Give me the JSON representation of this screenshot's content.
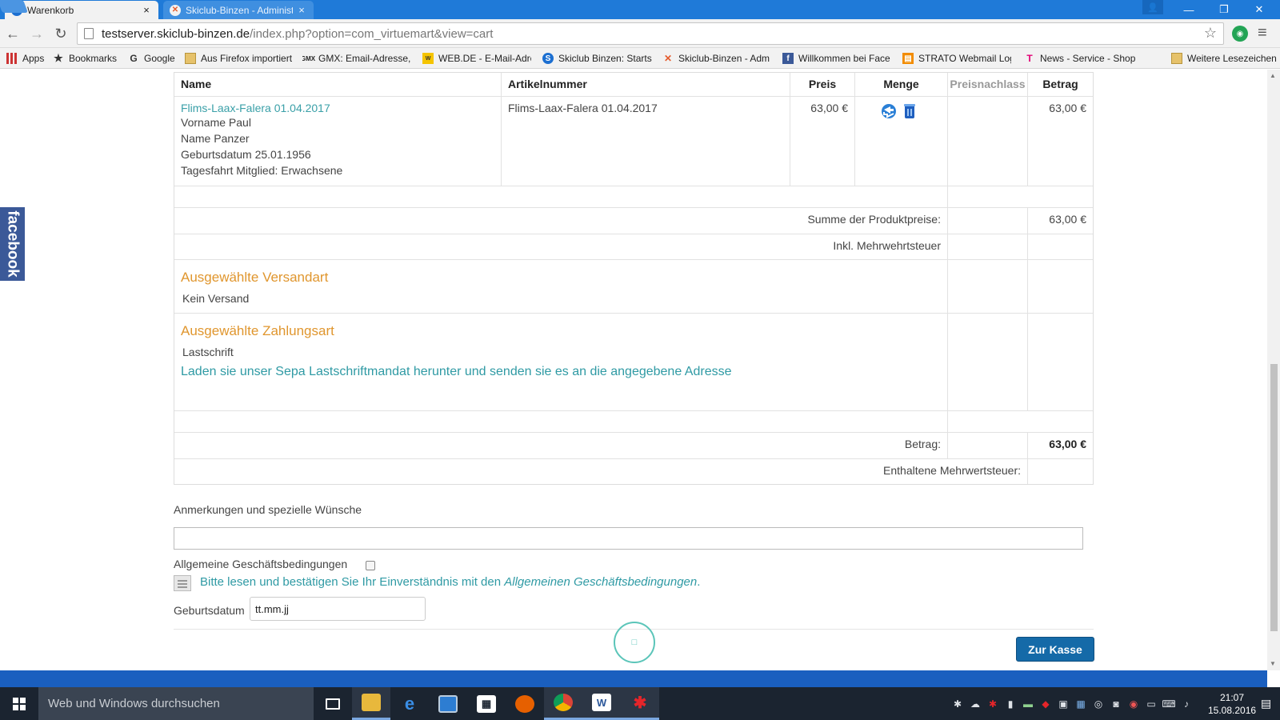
{
  "browser": {
    "tabs": [
      {
        "title": "Warenkorb",
        "close": "×",
        "favicon": "S"
      },
      {
        "title": "Skiclub-Binzen - Administ",
        "close": "×",
        "favicon": "✕"
      }
    ],
    "window_buttons": {
      "minimize": "—",
      "restore": "❐",
      "close": "✕",
      "profile": "👤"
    },
    "nav": {
      "back": "←",
      "forward": "→",
      "reload": "↻"
    },
    "url_host": "testserver.skiclub-binzen.de",
    "url_path": "/index.php?option=com_virtuemart&view=cart",
    "star": "☆",
    "menu": "≡",
    "bookmarks": [
      {
        "label": "Apps",
        "icon": "apps-icon"
      },
      {
        "label": "Bookmarks",
        "icon": "star-icon"
      },
      {
        "label": "Google",
        "icon": "google-icon"
      },
      {
        "label": "Aus Firefox importiert",
        "icon": "folder-icon"
      },
      {
        "label": "GMX: Email-Adresse,",
        "icon": "gmx-icon"
      },
      {
        "label": "WEB.DE - E-Mail-Adre",
        "icon": "webde-icon"
      },
      {
        "label": "Skiclub Binzen: Starts",
        "icon": "skiclub-icon"
      },
      {
        "label": "Skiclub-Binzen - Adm",
        "icon": "joomla-icon"
      },
      {
        "label": "Willkommen bei Face",
        "icon": "facebook-icon"
      },
      {
        "label": "STRATO Webmail Log",
        "icon": "strato-icon"
      },
      {
        "label": "News - Service - Shop",
        "icon": "telekom-icon"
      },
      {
        "label": "Weitere Lesezeichen",
        "icon": "folder-icon"
      }
    ]
  },
  "facebook_tab": "facebook",
  "cart": {
    "headers": {
      "name": "Name",
      "sku": "Artikelnummer",
      "price": "Preis",
      "qty": "Menge",
      "discount": "Preisnachlass",
      "total": "Betrag"
    },
    "item": {
      "link": "Flims-Laax-Falera 01.04.2017",
      "lines": [
        "Vorname Paul",
        "Name Panzer",
        "Geburtsdatum 25.01.1956",
        "Tagesfahrt Mitglied: Erwachsene"
      ],
      "sku": "Flims-Laax-Falera 01.04.2017",
      "price": "63,00 €",
      "total": "63,00 €"
    },
    "subtotal_label": "Summe der Produktpreise:",
    "subtotal_value": "63,00 €",
    "vat_included": "Inkl. Mehrwehrtsteuer",
    "shipping_title": "Ausgewählte Versandart",
    "shipping_value": "Kein Versand",
    "payment_title": "Ausgewählte Zahlungsart",
    "payment_value": "Lastschrift",
    "payment_note": "Laden sie unser Sepa Lastschriftmandat herunter und senden sie es an die angegebene Adresse",
    "total_label": "Betrag:",
    "total_value": "63,00 €",
    "vat_contained": "Enthaltene Mehrwertsteuer:"
  },
  "form": {
    "notes_label": "Anmerkungen und spezielle Wünsche",
    "agb_label": "Allgemeine Geschäftsbedingungen",
    "agb_text": "Bitte lesen und bestätigen Sie Ihr Einverständnis mit den ",
    "agb_link": "Allgemeinen Geschäftsbedingungen",
    "agb_dot": ".",
    "birth_label": "Geburtsdatum",
    "birth_value": "tt.mm.jj",
    "loading": "□",
    "checkout": "Zur Kasse"
  },
  "taskbar": {
    "search_placeholder": "Web und Windows durchsuchen",
    "clock_time": "21:07",
    "clock_date": "15.08.2016"
  },
  "colors": {
    "tab_bar": "#1f7ad8",
    "link_teal": "#3aa0a8",
    "section_orange": "#e0962e",
    "checkout_blue": "#156aa8",
    "taskbar": "#1b2430"
  }
}
